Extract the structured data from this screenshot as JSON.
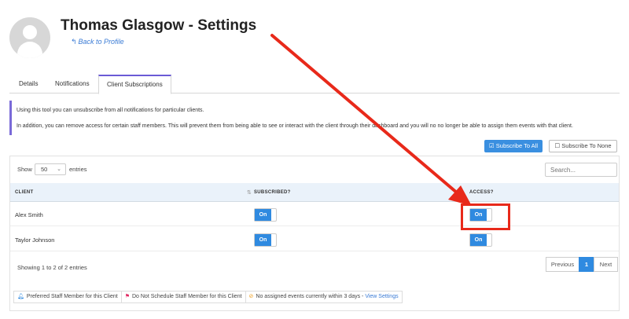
{
  "profile": {
    "title": "Thomas Glasgow - Settings",
    "back_link": "Back to Profile"
  },
  "tabs": [
    {
      "label": "Details"
    },
    {
      "label": "Notifications"
    },
    {
      "label": "Client Subscriptions",
      "active": true
    }
  ],
  "info": {
    "line1": "Using this tool you can unsubscribe from all notifications for particular clients.",
    "line2": "In addition, you can remove access for certain staff members. This will prevent them from being able to see or interact with the client through their dashboard and you will no no longer be able to assign them events with that client."
  },
  "actions": {
    "subscribe_all": "Subscribe To All",
    "subscribe_none": "Subscribe To None"
  },
  "table_controls": {
    "show_label": "Show",
    "entries_value": "50",
    "entries_label": "entries",
    "search_placeholder": "Search..."
  },
  "table": {
    "columns": [
      "CLIENT",
      "SUBSCRIBED?",
      "ACCESS?"
    ],
    "rows": [
      {
        "client": "Alex Smith",
        "subscribed": "On",
        "access": "On"
      },
      {
        "client": "Taylor Johnson",
        "subscribed": "On",
        "access": "On"
      }
    ]
  },
  "footer": {
    "showing": "Showing 1 to 2 of 2 entries",
    "previous": "Previous",
    "page": "1",
    "next": "Next"
  },
  "legend": {
    "preferred": "Preferred Staff Member for this Client",
    "do_not_schedule": "Do Not Schedule Staff Member for this Client",
    "no_events": "No assigned events currently within 3 days - ",
    "view_settings": "View Settings"
  },
  "colors": {
    "accent": "#2f8ae0",
    "tab_active": "#6b5bd6",
    "annotation": "#e8291a"
  }
}
